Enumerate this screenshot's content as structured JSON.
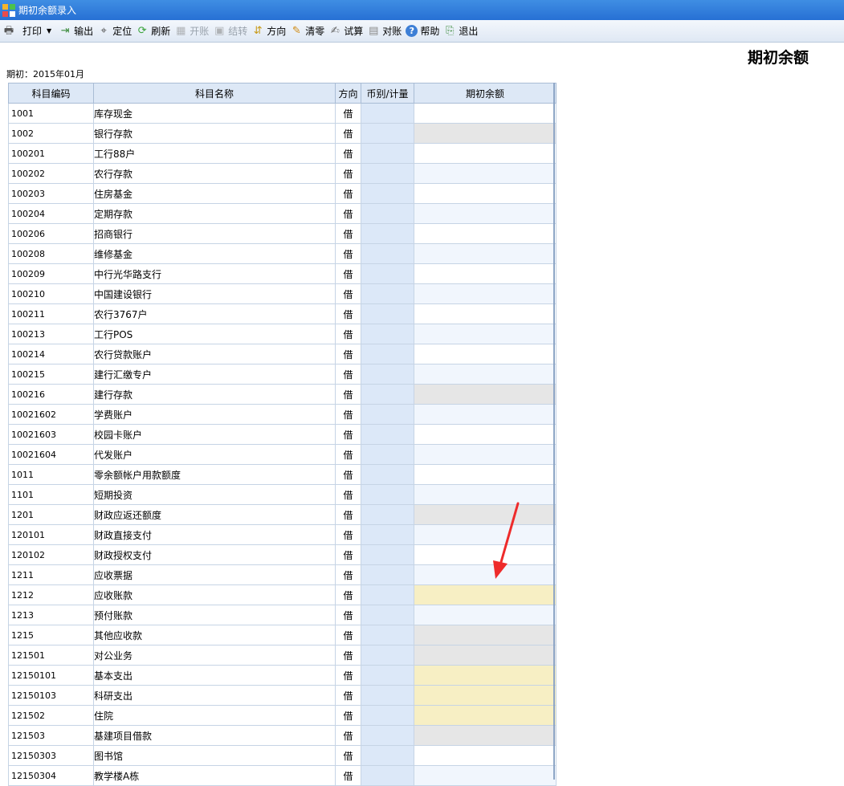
{
  "window": {
    "title": "期初余额录入"
  },
  "toolbar": [
    {
      "label": "打印",
      "icon": "printer-icon",
      "disabled": false,
      "dropdown": true
    },
    {
      "label": "输出",
      "icon": "export-icon",
      "disabled": false
    },
    {
      "label": "定位",
      "icon": "locate-icon",
      "disabled": false
    },
    {
      "label": "刷新",
      "icon": "refresh-icon",
      "disabled": false
    },
    {
      "label": "开账",
      "icon": "open-ledger-icon",
      "disabled": true
    },
    {
      "label": "结转",
      "icon": "carry-forward-icon",
      "disabled": true
    },
    {
      "label": "方向",
      "icon": "direction-icon",
      "disabled": false
    },
    {
      "label": "清零",
      "icon": "clear-icon",
      "disabled": false
    },
    {
      "label": "试算",
      "icon": "trial-balance-icon",
      "disabled": false
    },
    {
      "label": "对账",
      "icon": "reconcile-icon",
      "disabled": false
    },
    {
      "label": "帮助",
      "icon": "help-icon",
      "disabled": false
    },
    {
      "label": "退出",
      "icon": "exit-icon",
      "disabled": false
    }
  ],
  "heading": "期初余额",
  "period": "期初：2015年01月",
  "table": {
    "columns": [
      "科目编码",
      "科目名称",
      "方向",
      "币别/计量",
      "期初余额"
    ],
    "rows": [
      {
        "code": "1001",
        "name": "库存现金",
        "level": 1,
        "dir": "借",
        "balance": "",
        "fill": "plain"
      },
      {
        "code": "1002",
        "name": "银行存款",
        "level": 1,
        "dir": "借",
        "balance": "",
        "fill": "gray"
      },
      {
        "code": "100201",
        "name": "工行88户",
        "level": 2,
        "dir": "借",
        "balance": "",
        "fill": "plain"
      },
      {
        "code": "100202",
        "name": "农行存款",
        "level": 2,
        "dir": "借",
        "balance": "",
        "fill": "alt"
      },
      {
        "code": "100203",
        "name": "住房基金",
        "level": 2,
        "dir": "借",
        "balance": "",
        "fill": "plain"
      },
      {
        "code": "100204",
        "name": "定期存款",
        "level": 2,
        "dir": "借",
        "balance": "",
        "fill": "alt"
      },
      {
        "code": "100206",
        "name": "招商银行",
        "level": 2,
        "dir": "借",
        "balance": "",
        "fill": "plain"
      },
      {
        "code": "100208",
        "name": "维修基金",
        "level": 2,
        "dir": "借",
        "balance": "",
        "fill": "alt"
      },
      {
        "code": "100209",
        "name": "中行光华路支行",
        "level": 2,
        "dir": "借",
        "balance": "",
        "fill": "plain"
      },
      {
        "code": "100210",
        "name": "中国建设银行",
        "level": 2,
        "dir": "借",
        "balance": "",
        "fill": "alt"
      },
      {
        "code": "100211",
        "name": "农行3767户",
        "level": 2,
        "dir": "借",
        "balance": "",
        "fill": "plain"
      },
      {
        "code": "100213",
        "name": "工行POS",
        "level": 2,
        "dir": "借",
        "balance": "",
        "fill": "alt"
      },
      {
        "code": "100214",
        "name": "农行贷款账户",
        "level": 2,
        "dir": "借",
        "balance": "",
        "fill": "plain"
      },
      {
        "code": "100215",
        "name": "建行汇缴专户",
        "level": 2,
        "dir": "借",
        "balance": "",
        "fill": "alt"
      },
      {
        "code": "100216",
        "name": "建行存款",
        "level": 2,
        "dir": "借",
        "balance": "",
        "fill": "gray"
      },
      {
        "code": "10021602",
        "name": "学费账户",
        "level": 3,
        "dir": "借",
        "balance": "",
        "fill": "alt"
      },
      {
        "code": "10021603",
        "name": "校园卡账户",
        "level": 3,
        "dir": "借",
        "balance": "",
        "fill": "plain"
      },
      {
        "code": "10021604",
        "name": "代发账户",
        "level": 3,
        "dir": "借",
        "balance": "",
        "fill": "alt"
      },
      {
        "code": "1011",
        "name": "零余额帐户用款额度",
        "level": 1,
        "dir": "借",
        "balance": "",
        "fill": "plain"
      },
      {
        "code": "1101",
        "name": "短期投资",
        "level": 1,
        "dir": "借",
        "balance": "",
        "fill": "alt"
      },
      {
        "code": "1201",
        "name": "财政应返还额度",
        "level": 1,
        "dir": "借",
        "balance": "",
        "fill": "gray"
      },
      {
        "code": "120101",
        "name": "财政直接支付",
        "level": 2,
        "dir": "借",
        "balance": "",
        "fill": "alt"
      },
      {
        "code": "120102",
        "name": "财政授权支付",
        "level": 2,
        "dir": "借",
        "balance": "",
        "fill": "plain"
      },
      {
        "code": "1211",
        "name": "应收票据",
        "level": 1,
        "dir": "借",
        "balance": "",
        "fill": "alt"
      },
      {
        "code": "1212",
        "name": "应收账款",
        "level": 1,
        "dir": "借",
        "balance": "",
        "fill": "yellow"
      },
      {
        "code": "1213",
        "name": "预付账款",
        "level": 1,
        "dir": "借",
        "balance": "",
        "fill": "alt"
      },
      {
        "code": "1215",
        "name": "其他应收款",
        "level": 1,
        "dir": "借",
        "balance": "",
        "fill": "gray"
      },
      {
        "code": "121501",
        "name": "对公业务",
        "level": 2,
        "dir": "借",
        "balance": "",
        "fill": "gray"
      },
      {
        "code": "12150101",
        "name": "基本支出",
        "level": 3,
        "dir": "借",
        "balance": "",
        "fill": "yellow"
      },
      {
        "code": "12150103",
        "name": "科研支出",
        "level": 3,
        "dir": "借",
        "balance": "",
        "fill": "yellow"
      },
      {
        "code": "121502",
        "name": "住院",
        "level": 2,
        "dir": "借",
        "balance": "",
        "fill": "yellow"
      },
      {
        "code": "121503",
        "name": "基建项目借款",
        "level": 2,
        "dir": "借",
        "balance": "",
        "fill": "gray"
      },
      {
        "code": "12150303",
        "name": "图书馆",
        "level": 3,
        "dir": "借",
        "balance": "",
        "fill": "plain"
      },
      {
        "code": "12150304",
        "name": "教学楼A栋",
        "level": 3,
        "dir": "借",
        "balance": "",
        "fill": "alt"
      }
    ]
  },
  "colors": {
    "titlebar": "#2b76d8",
    "header": "#dde8f6",
    "currency_col": "#dce8f8",
    "balance_yellow": "#f7efc4",
    "balance_gray": "#e6e6e6",
    "arrow": "#ee2b2b"
  }
}
